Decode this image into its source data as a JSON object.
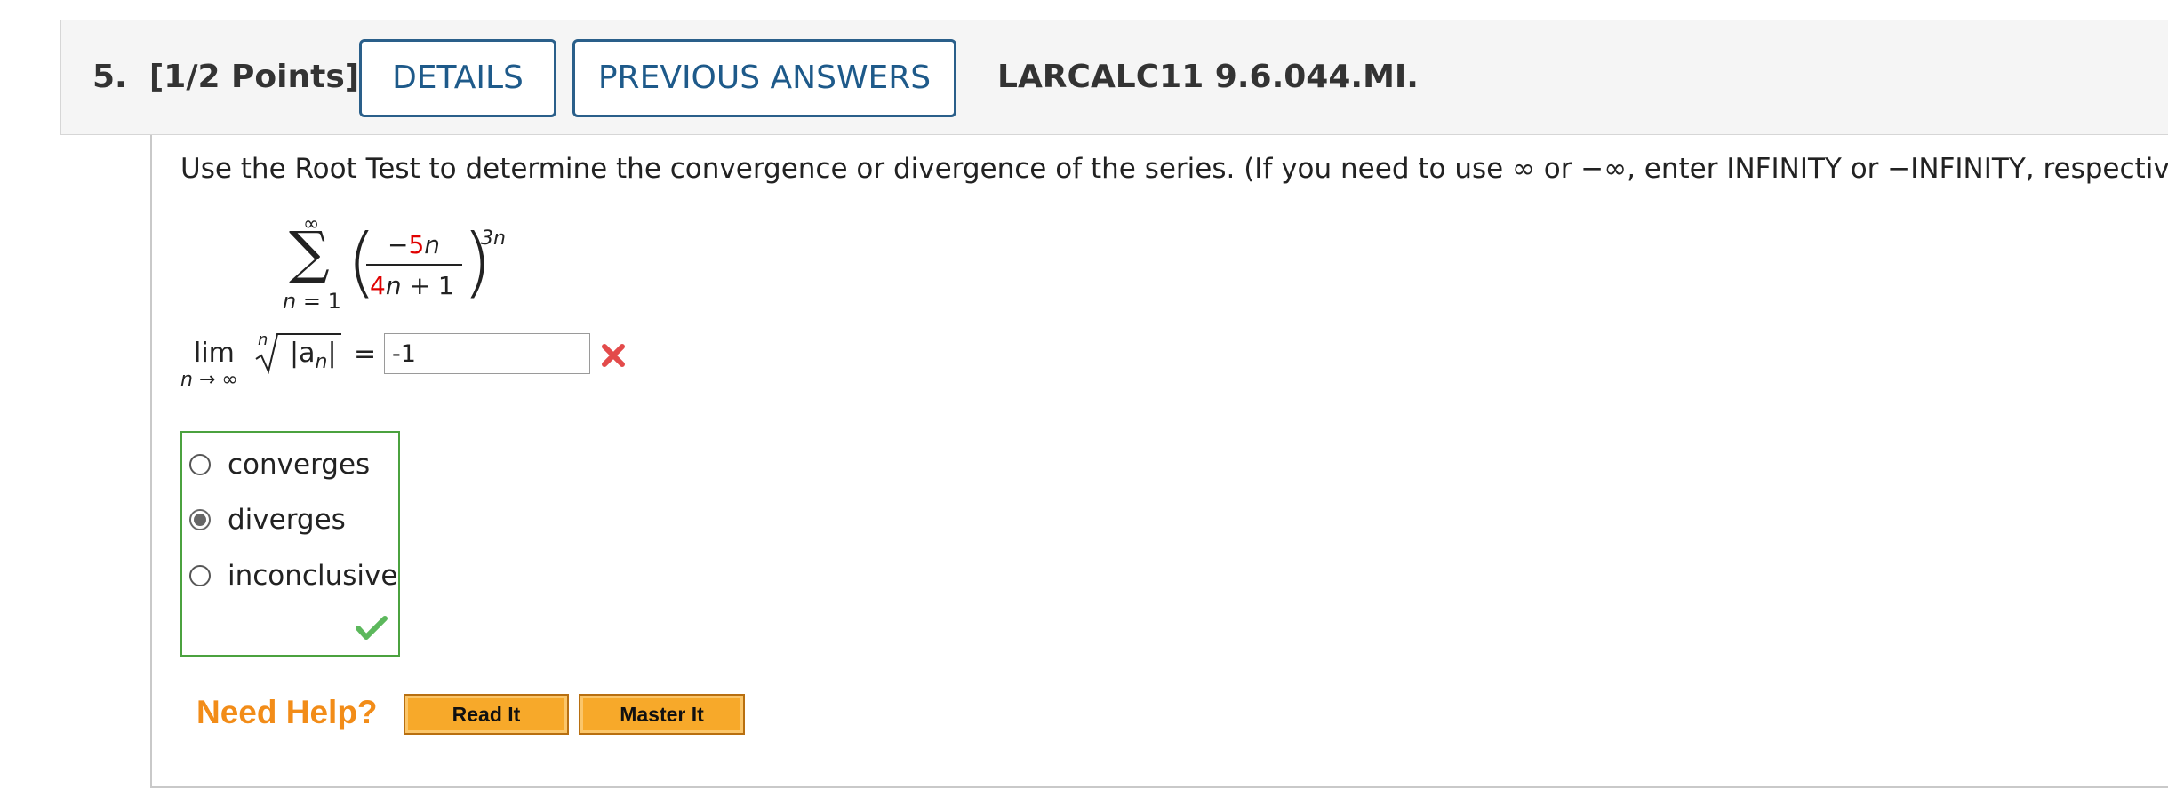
{
  "header": {
    "question_number": "5.",
    "points": "[1/2 Points]",
    "details_label": "DETAILS",
    "previous_answers_label": "PREVIOUS ANSWERS",
    "problem_id": "LARCALC11 9.6.044.MI."
  },
  "instructions": "Use the Root Test to determine the convergence or divergence of the series. (If you need to use ∞ or −∞, enter INFINITY or −INFINITY, respectively.)",
  "series": {
    "upper_limit": "∞",
    "lower_limit": "n = 1",
    "sigma": "∑",
    "numerator_sign": "−",
    "numerator_coef": "5",
    "numerator_var": "n",
    "denominator_coef": "4",
    "denominator_var": "n",
    "denominator_rest": " + 1",
    "exponent": "3n",
    "paren_left": "(",
    "paren_right": ")"
  },
  "limit": {
    "lim_word": "lim",
    "lim_sub": "n → ∞",
    "root_index": "n",
    "radicand_a": "|a",
    "radicand_sub": "n",
    "radicand_close": "|",
    "equals": "=",
    "answer_value": "-1",
    "answer_status": "incorrect",
    "status_icon": "x-mark-icon",
    "status_color": "#e34b4b"
  },
  "options": {
    "items": [
      {
        "label": "converges",
        "checked": false
      },
      {
        "label": "diverges",
        "checked": true
      },
      {
        "label": "inconclusive",
        "checked": false
      }
    ],
    "status": "correct",
    "status_icon": "checkmark-icon",
    "status_color": "#5cb85c",
    "border_color": "#4ba23f"
  },
  "help": {
    "title": "Need Help?",
    "read_it_label": "Read It",
    "master_it_label": "Master It",
    "title_color": "#f28c18",
    "button_color": "#f7a92a"
  }
}
